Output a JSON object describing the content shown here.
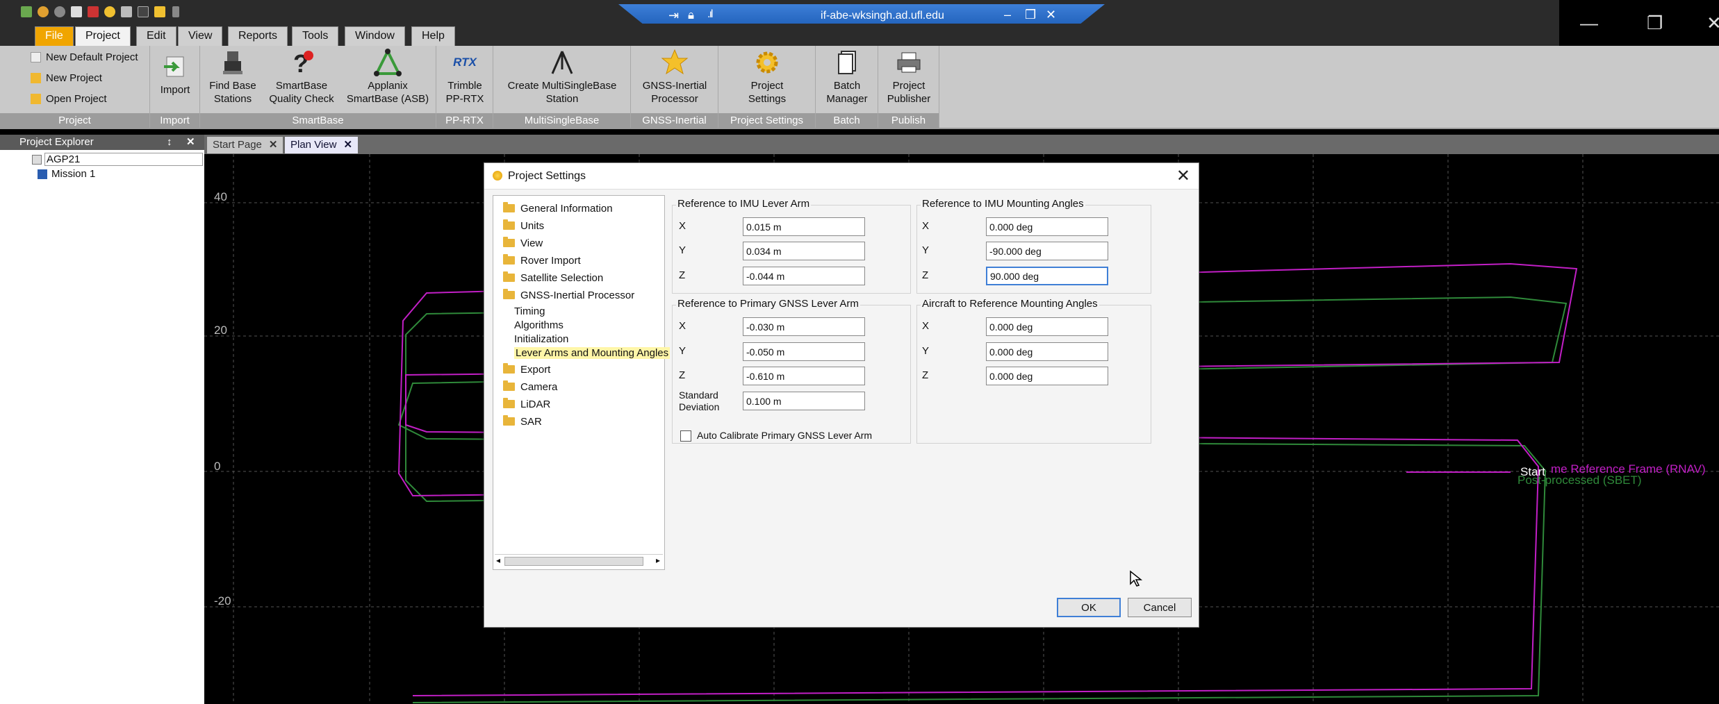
{
  "remote": {
    "host": "if-abe-wksingh.ad.ufl.edu",
    "minimize": "–",
    "restore": "❒",
    "close": "✕"
  },
  "menu_tabs": [
    "File",
    "Project",
    "Edit",
    "View",
    "Reports",
    "Tools",
    "Window",
    "Help"
  ],
  "ribbon": {
    "project_group": {
      "items": [
        "New Default Project",
        "New Project",
        "Open Project"
      ],
      "label": "Project"
    },
    "import_group": {
      "button": "Import",
      "label": "Import"
    },
    "smartbase_group": {
      "buttons": [
        {
          "line1": "Find Base",
          "line2": "Stations"
        },
        {
          "line1": "SmartBase",
          "line2": "Quality Check"
        },
        {
          "line1": "Applanix",
          "line2": "SmartBase (ASB)"
        }
      ],
      "label": "SmartBase"
    },
    "pprtx_group": {
      "line1": "Trimble",
      "line2": "PP-RTX",
      "label": "PP-RTX",
      "icon_text": "RTX"
    },
    "msb_group": {
      "line1": "Create MultiSingleBase",
      "line2": "Station",
      "label": "MultiSingleBase"
    },
    "gnss_group": {
      "line1": "GNSS-Inertial",
      "line2": "Processor",
      "label": "GNSS-Inertial"
    },
    "settings_group": {
      "line1": "Project",
      "line2": "Settings",
      "label": "Project Settings"
    },
    "batch_group": {
      "line1": "Batch",
      "line2": "Manager",
      "label": "Batch"
    },
    "publish_group": {
      "line1": "Project",
      "line2": "Publisher",
      "label": "Publish"
    }
  },
  "explorer": {
    "title": "Project Explorer",
    "pin": "↕",
    "close": "✕",
    "project": "AGP21",
    "mission": "Mission 1"
  },
  "doc_tabs": [
    {
      "label": "Start Page",
      "close": "✕"
    },
    {
      "label": "Plan View",
      "close": "✕"
    }
  ],
  "plan": {
    "y_ticks": [
      "40",
      "20",
      "0",
      "-20"
    ],
    "start_label": "Start",
    "rnav_label": "me Reference Frame (RNAV)",
    "sbet_label": "Post-processed (SBET)",
    "colors": {
      "rnav": "#c21fc6",
      "sbet": "#2f8a3a"
    }
  },
  "dialog": {
    "title": "Project Settings",
    "tree": [
      {
        "label": "General Information",
        "type": "folder"
      },
      {
        "label": "Units",
        "type": "folder"
      },
      {
        "label": "View",
        "type": "folder"
      },
      {
        "label": "Rover Import",
        "type": "folder"
      },
      {
        "label": "Satellite Selection",
        "type": "folder"
      },
      {
        "label": "GNSS-Inertial Processor",
        "type": "folder"
      },
      {
        "label": "Timing",
        "type": "child"
      },
      {
        "label": "Algorithms",
        "type": "child"
      },
      {
        "label": "Initialization",
        "type": "child"
      },
      {
        "label": "Lever Arms and Mounting Angles",
        "type": "child",
        "selected": true
      },
      {
        "label": "Export",
        "type": "folder"
      },
      {
        "label": "Camera",
        "type": "folder"
      },
      {
        "label": "LiDAR",
        "type": "folder"
      },
      {
        "label": "SAR",
        "type": "folder"
      }
    ],
    "imu_lever": {
      "title": "Reference to IMU Lever Arm",
      "x_label": "X",
      "x": "0.015 m",
      "y_label": "Y",
      "y": "0.034 m",
      "z_label": "Z",
      "z": "-0.044 m"
    },
    "imu_angles": {
      "title": "Reference to IMU Mounting Angles",
      "x_label": "X",
      "x": "0.000 deg",
      "y_label": "Y",
      "y": "-90.000 deg",
      "z_label": "Z",
      "z": "90.000 deg"
    },
    "gnss_lever": {
      "title": "Reference to Primary GNSS Lever Arm",
      "x_label": "X",
      "x": "-0.030 m",
      "y_label": "Y",
      "y": "-0.050 m",
      "z_label": "Z",
      "z": "-0.610 m",
      "sd_label_1": "Standard",
      "sd_label_2": "Deviation",
      "sd": "0.100 m",
      "auto_calibrate": "Auto Calibrate Primary GNSS Lever Arm",
      "auto_calibrate_checked": false
    },
    "aircraft_angles": {
      "title": "Aircraft to Reference Mounting Angles",
      "x_label": "X",
      "x": "0.000 deg",
      "y_label": "Y",
      "y": "0.000 deg",
      "z_label": "Z",
      "z": "0.000 deg"
    },
    "ok": "OK",
    "cancel": "Cancel",
    "close": "✕"
  }
}
